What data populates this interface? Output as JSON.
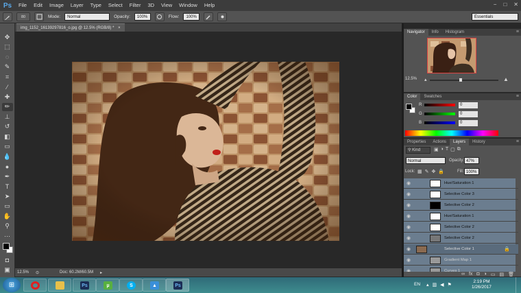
{
  "menubar": {
    "logo": "Ps",
    "items": [
      "File",
      "Edit",
      "Image",
      "Layer",
      "Type",
      "Select",
      "Filter",
      "3D",
      "View",
      "Window",
      "Help"
    ],
    "window_controls": [
      "−",
      "□",
      "✕"
    ]
  },
  "options_bar": {
    "brush_size": "80",
    "mode_label": "Mode:",
    "mode_value": "Normal",
    "opacity_label": "Opacity:",
    "opacity_value": "100%",
    "flow_label": "Flow:",
    "flow_value": "100%",
    "workspace": "Essentials"
  },
  "document": {
    "tab_title": "img_1152_16139297816_o.jpg @ 12.5% (RGB/8) *",
    "tab_close": "×"
  },
  "status": {
    "zoom": "12.5%",
    "doc_size": "Doc: 60.2M/60.5M"
  },
  "navigator": {
    "tabs": [
      "Navigator",
      "Info",
      "Histogram"
    ],
    "zoom": "12.5%",
    "zoom_level": 0.45
  },
  "color": {
    "tabs": [
      "Color",
      "Swatches"
    ],
    "r_label": "R",
    "r_value": "0",
    "g_label": "G",
    "g_value": "0",
    "b_label": "B",
    "b_value": "0"
  },
  "panel_tabs2": {
    "tabs": [
      "Properties",
      "Actions",
      "Layers",
      "History"
    ]
  },
  "layers": {
    "kind_label": "Kind",
    "blend_mode": "Normal",
    "opacity_label": "Opacity:",
    "opacity_value": "47%",
    "lock_label": "Lock:",
    "fill_label": "Fill:",
    "fill_value": "100%",
    "items": [
      {
        "name": "Hue/Saturation 1"
      },
      {
        "name": "Selective Color 3"
      },
      {
        "name": "Selective Color 2"
      },
      {
        "name": "Hue/Saturation 1"
      },
      {
        "name": "Selective Color 2"
      },
      {
        "name": "Selective Color 2"
      },
      {
        "name": "Selective Color 1"
      },
      {
        "name": "Gradient Map 1"
      },
      {
        "name": "Curves 1"
      }
    ]
  },
  "taskbar": {
    "lang": "EN",
    "time": "2:19 PM",
    "date": "1/26/2017"
  }
}
